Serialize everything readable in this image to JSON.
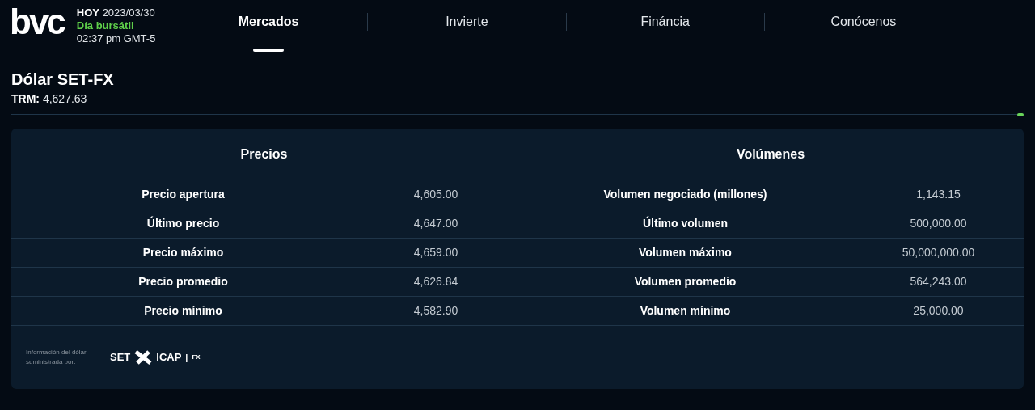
{
  "header": {
    "logo": "bvc",
    "today_label": "HOY",
    "date": "2023/03/30",
    "market_status": "Día bursátil",
    "time": "02:37 pm GMT-5"
  },
  "nav": [
    {
      "label": "Mercados",
      "selected": true
    },
    {
      "label": "Invierte",
      "selected": false
    },
    {
      "label": "Fináncia",
      "selected": false
    },
    {
      "label": "Conócenos",
      "selected": false
    }
  ],
  "title": "Dólar SET-FX",
  "trm_label": "TRM:",
  "trm_value": "4,627.63",
  "prices": {
    "heading": "Precios",
    "rows": [
      {
        "label": "Precio apertura",
        "value": "4,605.00"
      },
      {
        "label": "Último precio",
        "value": "4,647.00"
      },
      {
        "label": "Precio máximo",
        "value": "4,659.00"
      },
      {
        "label": "Precio promedio",
        "value": "4,626.84"
      },
      {
        "label": "Precio mínimo",
        "value": "4,582.90"
      }
    ]
  },
  "volumes": {
    "heading": "Volúmenes",
    "rows": [
      {
        "label": "Volumen negociado (millones)",
        "value": "1,143.15"
      },
      {
        "label": "Último volumen",
        "value": "500,000.00"
      },
      {
        "label": "Volumen máximo",
        "value": "50,000,000.00"
      },
      {
        "label": "Volumen promedio",
        "value": "564,243.00"
      },
      {
        "label": "Volumen mínimo",
        "value": "25,000.00"
      }
    ]
  },
  "footer": {
    "note": "Información del dólar suministrada por:",
    "provider_left": "SET",
    "provider_right": "ICAP",
    "provider_sep": "|",
    "provider_suffix": "FX"
  }
}
